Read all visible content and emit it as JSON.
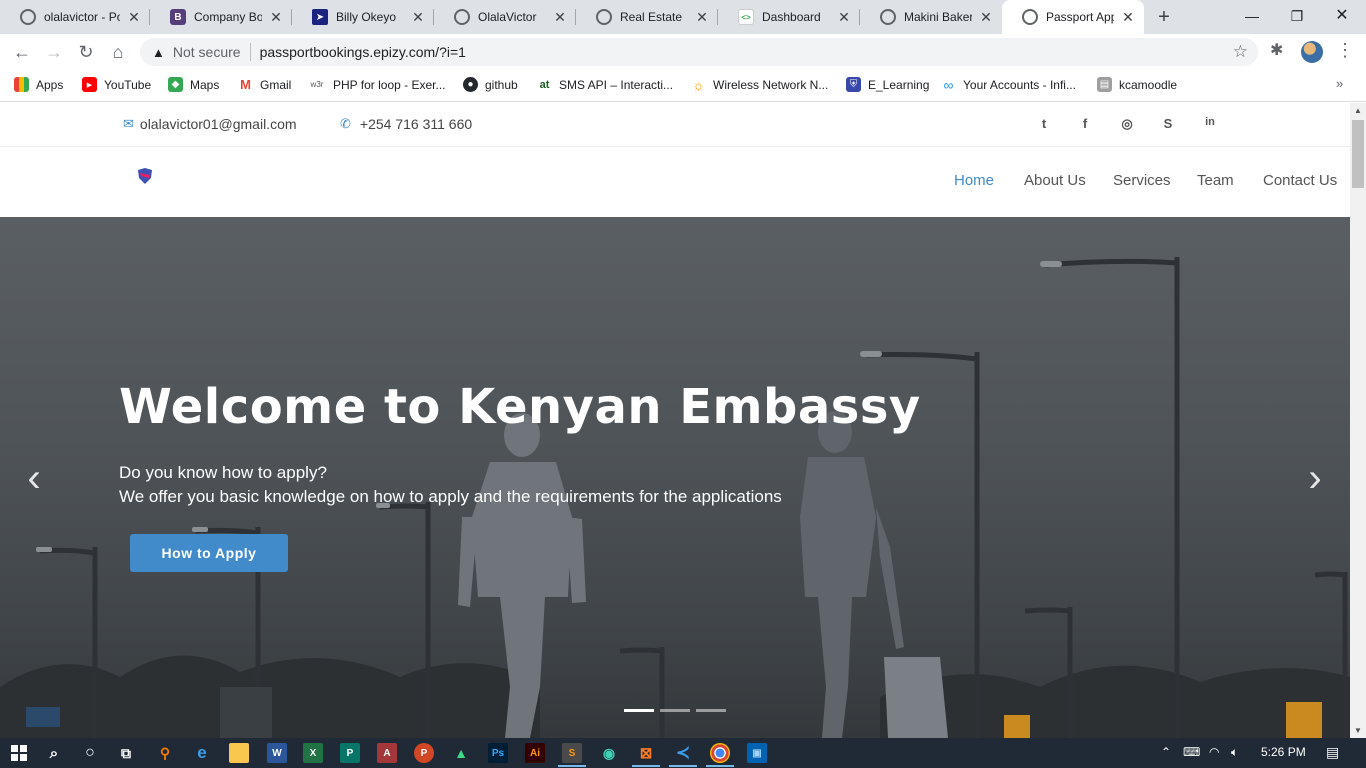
{
  "browser": {
    "tabs": [
      {
        "title": "olalavictor - Po",
        "icon": "globe-icon",
        "color": "#5f6368"
      },
      {
        "title": "Company Boot",
        "icon": "bootstrap-icon",
        "color": "#563d7c",
        "glyph": "B"
      },
      {
        "title": "Billy Okeyo",
        "icon": "bird-icon",
        "color": "#1a237e"
      },
      {
        "title": "OlalaVictor",
        "icon": "globe-icon",
        "color": "#5f6368"
      },
      {
        "title": "Real Estate",
        "icon": "globe-icon",
        "color": "#5f6368"
      },
      {
        "title": "Dashboard",
        "icon": "code-icon",
        "color": "#ffffff",
        "glyph": "<>"
      },
      {
        "title": "Makini Bakery",
        "icon": "globe-icon",
        "color": "#5f6368"
      },
      {
        "title": "Passport Appli",
        "icon": "globe-icon",
        "color": "#5f6368",
        "active": true
      }
    ],
    "new_tab": "+",
    "address": {
      "security": "Not secure",
      "url": "passportbookings.epizy.com/?i=1"
    },
    "bookmarks": [
      {
        "label": "Apps",
        "icon": "apps-grid-icon",
        "color": "#4285f4"
      },
      {
        "label": "YouTube",
        "icon": "youtube-icon",
        "color": "#ff0000"
      },
      {
        "label": "Maps",
        "icon": "maps-icon",
        "color": "#34a853"
      },
      {
        "label": "Gmail",
        "icon": "gmail-icon",
        "color": "#ea4335",
        "glyph": "M"
      },
      {
        "label": "PHP for loop - Exer...",
        "icon": "w3schools-icon",
        "color": "#555555",
        "glyph": "w3r"
      },
      {
        "label": "github",
        "icon": "github-icon",
        "color": "#24292e"
      },
      {
        "label": "SMS API – Interacti...",
        "icon": "at-icon",
        "color": "#1b5e20",
        "glyph": "at"
      },
      {
        "label": "Wireless Network N...",
        "icon": "sun-icon",
        "color": "#ff9800"
      },
      {
        "label": "E_Learning",
        "icon": "shield-icon",
        "color": "#3949ab"
      },
      {
        "label": "Your Accounts - Infi...",
        "icon": "infinity-icon",
        "color": "#2196f3",
        "glyph": "∞"
      },
      {
        "label": "kcamoodle",
        "icon": "moodle-icon",
        "color": "#757575"
      }
    ]
  },
  "site": {
    "topbar": {
      "email": "olalavictor01@gmail.com",
      "phone": "+254 716 311 660",
      "social": [
        {
          "name": "twitter-icon",
          "glyph": "t"
        },
        {
          "name": "facebook-icon",
          "glyph": "f"
        },
        {
          "name": "instagram-icon",
          "glyph": "◎"
        },
        {
          "name": "skype-icon",
          "glyph": "S"
        },
        {
          "name": "linkedin-icon",
          "glyph": "in"
        }
      ]
    },
    "nav": [
      {
        "label": "Home",
        "active": true
      },
      {
        "label": "About Us"
      },
      {
        "label": "Services"
      },
      {
        "label": "Team"
      },
      {
        "label": "Contact Us"
      }
    ],
    "hero": {
      "title": "Welcome to Kenyan Embassy",
      "line1": "Do you know how to apply?",
      "line2": "We offer you basic knowledge on how to apply and the requirements for the applications",
      "cta": "How to Apply",
      "prev": "‹",
      "next": "›",
      "slides": 3,
      "active_slide": 0
    }
  },
  "taskbar": {
    "apps": [
      {
        "name": "search-icon",
        "glyph": "⌕",
        "color": "transparent"
      },
      {
        "name": "cortana-icon",
        "glyph": "○",
        "color": "transparent"
      },
      {
        "name": "task-view-icon",
        "glyph": "⧉",
        "color": "transparent"
      },
      {
        "name": "search-app-icon",
        "glyph": "⚲",
        "color": "#f57c00"
      },
      {
        "name": "edge-icon",
        "glyph": "e",
        "color": "#0078d7"
      },
      {
        "name": "file-explorer-icon",
        "glyph": "▬",
        "color": "#f9c74f"
      },
      {
        "name": "word-icon",
        "glyph": "W",
        "color": "#2b579a"
      },
      {
        "name": "excel-icon",
        "glyph": "X",
        "color": "#217346"
      },
      {
        "name": "publisher-icon",
        "glyph": "P",
        "color": "#077568"
      },
      {
        "name": "access-icon",
        "glyph": "A",
        "color": "#a4373a"
      },
      {
        "name": "powerpoint-icon",
        "glyph": "P",
        "color": "#d24726"
      },
      {
        "name": "android-studio-icon",
        "glyph": "▲",
        "color": "#3ddc84"
      },
      {
        "name": "photoshop-icon",
        "glyph": "Ps",
        "color": "#001e36"
      },
      {
        "name": "illustrator-icon",
        "glyph": "Ai",
        "color": "#330000"
      },
      {
        "name": "sublime-icon",
        "glyph": "S",
        "color": "#ff9800"
      },
      {
        "name": "gitkraken-icon",
        "glyph": "◉",
        "color": "#179287"
      },
      {
        "name": "xampp-icon",
        "glyph": "⊠",
        "color": "#fb7a24"
      },
      {
        "name": "vscode-icon",
        "glyph": "≺",
        "color": "#007acc"
      },
      {
        "name": "chrome-icon",
        "glyph": "◍",
        "color": "#db4437"
      },
      {
        "name": "photos-icon",
        "glyph": "▣",
        "color": "#0063b1"
      }
    ],
    "time": "5:26 PM"
  }
}
